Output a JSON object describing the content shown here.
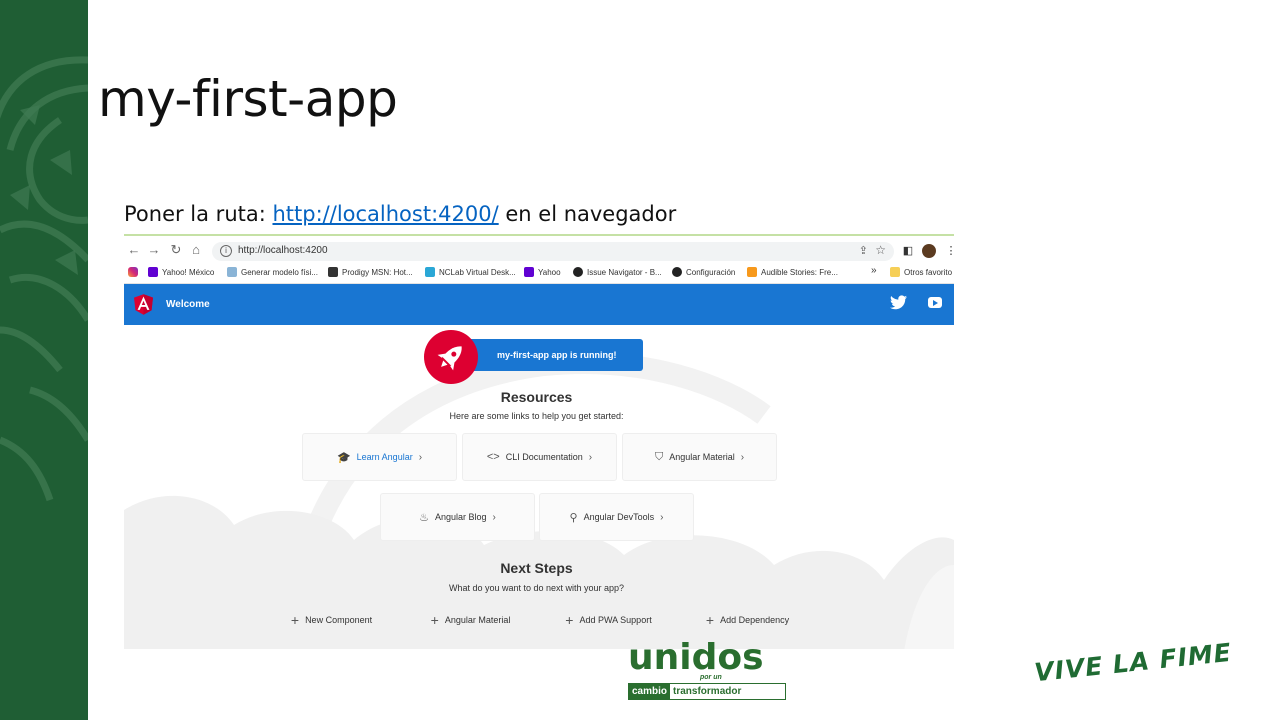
{
  "slide": {
    "title": "my-first-app",
    "instruction_prefix": "Poner la ruta: ",
    "instruction_link": "http://localhost:4200/",
    "instruction_suffix": " en el navegador"
  },
  "browser": {
    "url": "http://localhost:4200",
    "bookmarks": [
      {
        "label": "Yahoo! México",
        "icon": "yahoo-icon"
      },
      {
        "label": "Generar modelo físi...",
        "icon": "diagram-icon"
      },
      {
        "label": "Prodigy MSN: Hot...",
        "icon": "prodigy-icon"
      },
      {
        "label": "NCLab Virtual Desk...",
        "icon": "cube-icon"
      },
      {
        "label": "Yahoo",
        "icon": "yahoo-icon"
      },
      {
        "label": "Issue Navigator - B...",
        "icon": "globe-icon"
      },
      {
        "label": "Configuración",
        "icon": "gear-icon"
      },
      {
        "label": "Audible Stories: Fre...",
        "icon": "audible-icon"
      }
    ],
    "more_bookmarks": "»",
    "other_favorites": "Otros favorito"
  },
  "app": {
    "toolbar_title": "Welcome",
    "running_message": "my-first-app app is running!",
    "resources_title": "Resources",
    "resources_subtitle": "Here are some links to help you get started:",
    "resources": [
      {
        "label": "Learn Angular",
        "icon": "graduation-cap-icon"
      },
      {
        "label": "CLI Documentation",
        "icon": "code-icon"
      },
      {
        "label": "Angular Material",
        "icon": "shield-icon"
      },
      {
        "label": "Angular Blog",
        "icon": "flame-icon"
      },
      {
        "label": "Angular DevTools",
        "icon": "search-icon"
      }
    ],
    "next_title": "Next Steps",
    "next_subtitle": "What do you want to do next with your app?",
    "steps": [
      {
        "label": "New Component"
      },
      {
        "label": "Angular Material"
      },
      {
        "label": "Add PWA Support"
      },
      {
        "label": "Add Dependency"
      }
    ]
  },
  "logos": {
    "unidos": "unidos",
    "por_un": "por un",
    "cambio": "cambio",
    "transformador": "transformador",
    "vive": "VIVE LA FIME"
  },
  "colors": {
    "side_band": "#1f5e34",
    "angular_blue": "#1976d2",
    "angular_red": "#dd0031",
    "link": "#0563c1"
  }
}
